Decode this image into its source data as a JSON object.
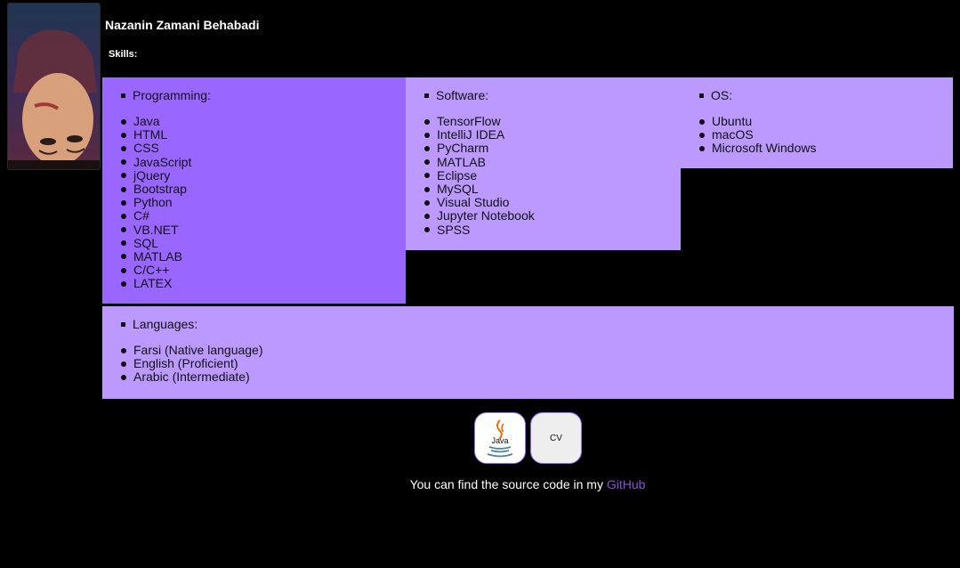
{
  "profile": {
    "name": "Nazanin Zamani Behabadi",
    "skills_heading": "Skills:"
  },
  "sections": {
    "programming": {
      "title": "Programming:",
      "items": [
        "Java",
        "HTML",
        "CSS",
        "JavaScript",
        "jQuery",
        "Bootstrap",
        "Python",
        "C#",
        "VB.NET",
        "SQL",
        "MATLAB",
        "C/C++",
        "LATEX"
      ]
    },
    "software": {
      "title": "Software:",
      "items": [
        "TensorFlow",
        "IntelliJ IDEA",
        "PyCharm",
        "MATLAB",
        "Eclipse",
        "MySQL",
        "Visual Studio",
        "Jupyter Notebook",
        "SPSS"
      ]
    },
    "os": {
      "title": "OS:",
      "items": [
        "Ubuntu",
        "macOS",
        "Microsoft Windows"
      ]
    },
    "languages": {
      "title": "Languages:",
      "items": [
        "Farsi (Native language)",
        "English (Proficient)",
        "Arabic (Intermediate)"
      ]
    }
  },
  "buttons": {
    "java_label": "Java",
    "cv_label": "CV"
  },
  "footer": {
    "text": "You can find the source code in my",
    "link_label": "GitHub"
  },
  "colors": {
    "background": "#000000",
    "programming_box": "#9966ff",
    "other_boxes": "#bb99ff",
    "link": "#8a4fd6"
  }
}
